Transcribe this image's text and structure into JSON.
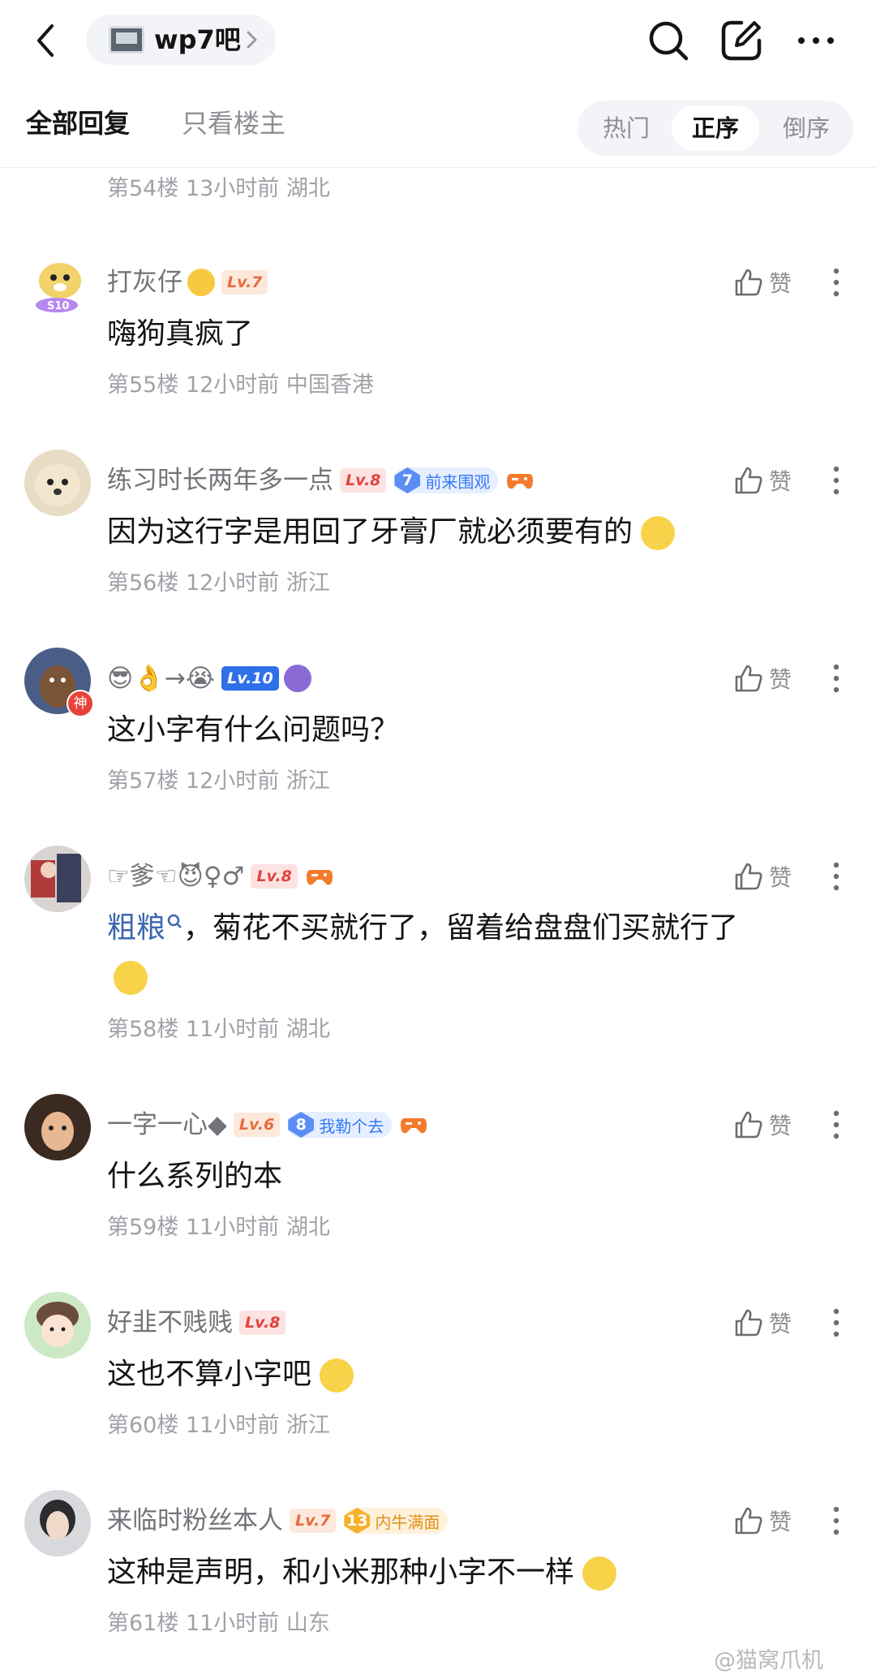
{
  "header": {
    "forum_name": "wp7吧"
  },
  "tabs": {
    "all_replies": "全部回复",
    "only_op": "只看楼主",
    "sort": [
      "热门",
      "正序",
      "倒序"
    ],
    "sort_selected": "正序"
  },
  "first_meta": "第54楼 13小时前 湖北",
  "like_label": "赞",
  "replies": [
    {
      "name": "打灰仔",
      "level": "Lv.7",
      "content": "嗨狗真疯了",
      "meta": "第55楼 12小时前 中国香港"
    },
    {
      "name": "练习时长两年多一点",
      "level": "Lv.8",
      "badge_num": "7",
      "badge_text": "前来围观",
      "content": "因为这行字是用回了牙膏厂就必须要有的",
      "meta": "第56楼 12小时前 浙江"
    },
    {
      "name": "😎👌→😭",
      "level": "Lv.10",
      "avatar_badge": "神",
      "content": "这小字有什么问题吗？",
      "meta": "第57楼 12小时前 浙江"
    },
    {
      "name": "☞爹☜😈♀♂",
      "level": "Lv.8",
      "mention": "粗粮",
      "content": "，菊花不买就行了，留着给盘盘们买就行了",
      "meta": "第58楼 11小时前 湖北"
    },
    {
      "name": "一字一心◆",
      "level": "Lv.6",
      "badge_num": "8",
      "badge_text": "我勒个去",
      "content": "什么系列的本",
      "meta": "第59楼 11小时前 湖北"
    },
    {
      "name": "好韭不贱贱",
      "level": "Lv.8",
      "content": "这也不算小字吧",
      "meta": "第60楼 11小时前 浙江"
    },
    {
      "name": "来临时粉丝本人",
      "level": "Lv.7",
      "badge_num": "13",
      "badge_text": "内牛满面",
      "content": "这种是声明，和小米那种小字不一样",
      "meta": "第61楼 11小时前 山东"
    }
  ],
  "watermark": "@猫窝爪机",
  "colors": {
    "accent_blue": "#3478f6",
    "level_orange": "#e46d3b",
    "level_red": "#e0443d",
    "meta_gray": "#a1a2a8"
  }
}
